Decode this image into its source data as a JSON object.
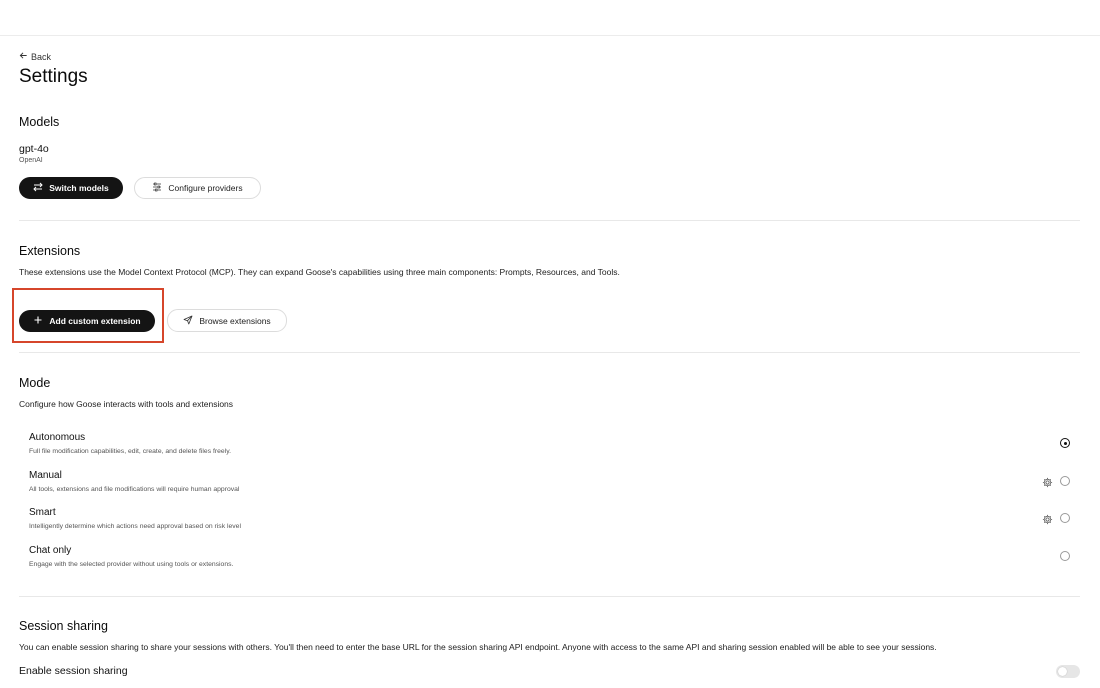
{
  "nav": {
    "back_label": "Back"
  },
  "page": {
    "title": "Settings"
  },
  "models": {
    "title": "Models",
    "current_model": "gpt-4o",
    "provider": "OpenAI",
    "switch_button": "Switch models",
    "configure_button": "Configure providers"
  },
  "extensions": {
    "title": "Extensions",
    "description": "These extensions use the Model Context Protocol (MCP). They can expand Goose's capabilities using three main components: Prompts, Resources, and Tools.",
    "add_button": "Add custom extension",
    "browse_button": "Browse extensions"
  },
  "mode": {
    "title": "Mode",
    "description": "Configure how Goose interacts with tools and extensions",
    "options": [
      {
        "label": "Autonomous",
        "description": "Full file modification capabilities, edit, create, and delete files freely.",
        "selected": true,
        "has_settings": false
      },
      {
        "label": "Manual",
        "description": "All tools, extensions and file modifications will require human approval",
        "selected": false,
        "has_settings": true
      },
      {
        "label": "Smart",
        "description": "Intelligently determine which actions need approval based on risk level",
        "selected": false,
        "has_settings": true
      },
      {
        "label": "Chat only",
        "description": "Engage with the selected provider without using tools or extensions.",
        "selected": false,
        "has_settings": false
      }
    ]
  },
  "session_sharing": {
    "title": "Session sharing",
    "description": "You can enable session sharing to share your sessions with others. You'll then need to enter the base URL for the session sharing API endpoint. Anyone with access to the same API and sharing session enabled will be able to see your sessions.",
    "toggle_label": "Enable session sharing",
    "enabled": false
  },
  "colors": {
    "primary_button": "#141414",
    "highlight": "#d6462b"
  }
}
